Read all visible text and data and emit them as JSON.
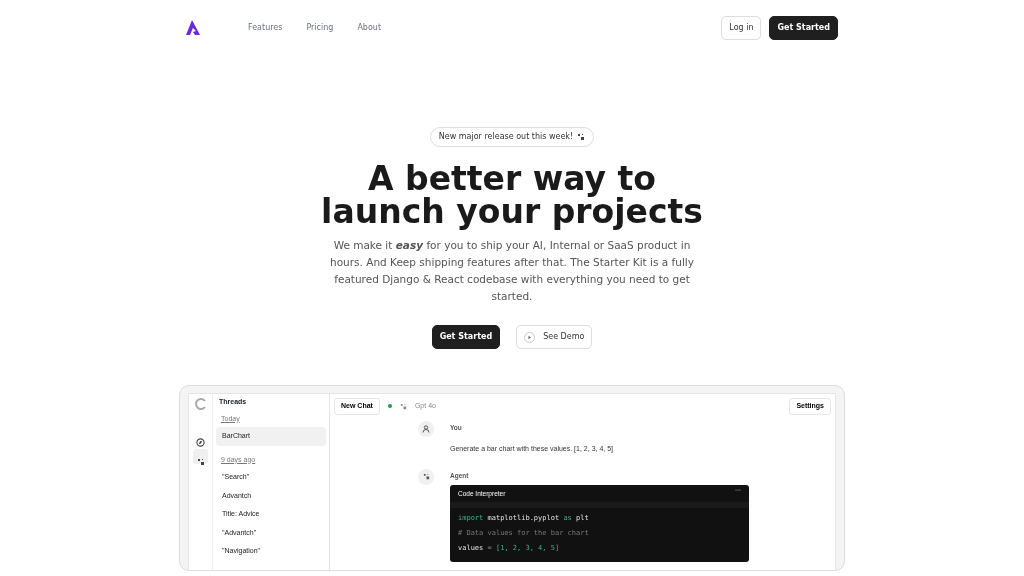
{
  "nav": {
    "links": [
      "Features",
      "Pricing",
      "About"
    ],
    "login": "Log in",
    "cta": "Get Started"
  },
  "hero": {
    "announcement": "New major release out this week!",
    "title_lines": [
      "A better way to",
      "launch your projects"
    ],
    "description": "We make it **easy** for you to ship your AI, Internal or SaaS product in hours. And Keep shipping features after that. The Starter Kit is a fully featured Django & React codebase with everything you need to get started.",
    "primary_button": "Get Started",
    "secondary_button": "See Demo"
  },
  "app": {
    "sidebar": {
      "title": "Threads",
      "groups": [
        {
          "label": "Today",
          "items": [
            {
              "label": "BarChart",
              "selected": true
            }
          ]
        },
        {
          "label": "9 days ago",
          "items": [
            {
              "label": "\"Search\"",
              "selected": false
            },
            {
              "label": "Advantch",
              "selected": false
            },
            {
              "label": "Title: Advice",
              "selected": false
            },
            {
              "label": "\"Advantch\"",
              "selected": false
            },
            {
              "label": "\"Navigation\"",
              "selected": false
            }
          ]
        }
      ]
    },
    "rail": [
      {
        "kind": "compass",
        "selected": false
      },
      {
        "kind": "agents",
        "selected": true
      }
    ],
    "toolbar": {
      "new_chat": "New Chat",
      "connected": true,
      "model": "Gpt 4o",
      "settings": "Settings"
    },
    "messages": [
      {
        "kind": "user",
        "author": "You",
        "text": "Generate a bar chart with these values. [1, 2, 3, 4, 5]"
      },
      {
        "kind": "agent",
        "author": "Agent",
        "code": {
          "title": "Code Interpreter",
          "lines": [
            [
              {
                "kind": "keyword",
                "t": "import"
              },
              {
                "kind": "plain",
                "t": " matplotlib.pyplot "
              },
              {
                "kind": "keyword",
                "t": "as"
              },
              {
                "kind": "plain",
                "t": " plt"
              }
            ],
            [
              {
                "kind": "comment",
                "t": "# Data values for the bar chart"
              }
            ],
            [
              {
                "kind": "plain",
                "t": "values"
              },
              {
                "kind": "op",
                "t": " = "
              },
              {
                "kind": "number",
                "t": "[1, 2, 3, 4, 5]"
              }
            ]
          ]
        }
      }
    ]
  }
}
